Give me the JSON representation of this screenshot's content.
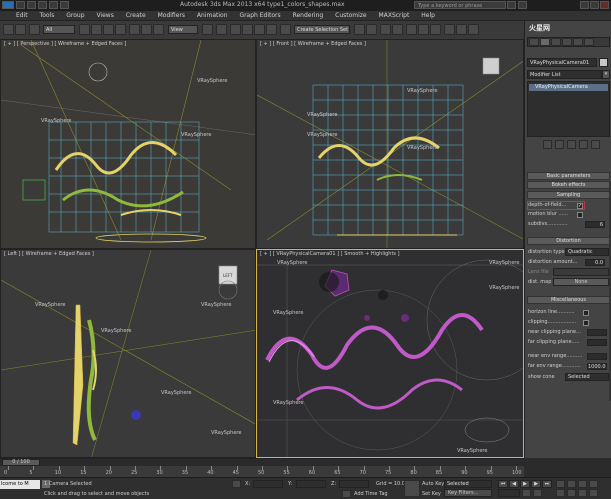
{
  "window": {
    "title": "Autodesk 3ds Max 2013 x64    type1_colors_shapes.max",
    "search_placeholder": "Type a keyword or phrase"
  },
  "menu": [
    "Edit",
    "Tools",
    "Group",
    "Views",
    "Create",
    "Modifiers",
    "Animation",
    "Graph Editors",
    "Rendering",
    "Customize",
    "MAXScript",
    "Help"
  ],
  "toolbar": {
    "selection_filter": "All",
    "reference_coord": "View",
    "named_selection": "Create Selection Set"
  },
  "viewports": {
    "top_left": {
      "label": "[ + ] [ Perspective ] [ Wireframe + Edged Faces ]",
      "objects": [
        "VRaySphere",
        "VRaySphere",
        "VRaySphere"
      ]
    },
    "top_right": {
      "label": "[ + ] [ Front ] [ Wireframe + Edged Faces ]",
      "objects": [
        "VRaySphere",
        "VRaySphere",
        "VRaySphere",
        "VRaySphere"
      ]
    },
    "bottom_left": {
      "label": "[ Left ] [ Wireframe + Edged Faces ]",
      "objects": [
        "VRaySphere",
        "VRaySphere",
        "VRaySphere",
        "VRaySphere",
        "VRaySphere"
      ],
      "viewcube": "LEFT"
    },
    "bottom_right": {
      "label": "[ + ] [ VRayPhysicalCamera01 ] [ Smooth + Highlights ]",
      "objects": [
        "VRaySphere",
        "VRaySphere",
        "VRaySphere",
        "VRaySphere",
        "VRaySphere",
        "VRaySphere"
      ]
    }
  },
  "command_panel": {
    "object_name": "VRayPhysicalCamera01",
    "modifier_list": "Modifier List",
    "stack_item": "VRayPhysicalCamera",
    "rollouts": {
      "basic": "Basic parameters",
      "bokeh": "Bokeh effects",
      "sampling": "Sampling",
      "distortion": "Distortion",
      "misc": "Miscellaneous"
    },
    "sampling": {
      "dof": "depth-of-field...",
      "motion_blur": "motion blur ......",
      "subdivs": "subdivs.............",
      "subdivs_value": "6"
    },
    "distortion": {
      "type_label": "distortion type",
      "type_value": "Quadratic",
      "amount_label": "distortion amount...",
      "amount_value": "0.0",
      "lens_file_label": "Lens file",
      "dist_map_label": "dist. map",
      "none_label": "None"
    },
    "misc": {
      "horizon": "horizon line...........",
      "clipping": "clipping..................",
      "near_clip": "near clipping plane...",
      "far_clip": "far clipping plane.....",
      "near_env": "near env range..........",
      "far_env": "far env range............",
      "far_env_value": "1000.0",
      "show_cone": "show cone",
      "show_cone_value": "Selected"
    }
  },
  "timeline": {
    "frame_counter": "0 / 100",
    "ticks": [
      "0",
      "5",
      "10",
      "15",
      "20",
      "25",
      "30",
      "35",
      "40",
      "45",
      "50",
      "55",
      "60",
      "65",
      "70",
      "75",
      "80",
      "85",
      "90",
      "95",
      "100"
    ]
  },
  "status": {
    "maxscript": "lcome to M",
    "selected": "1 Camera Selected",
    "prompt": "Click and drag to select and move objects",
    "x_label": "X:",
    "y_label": "Y:",
    "z_label": "Z:",
    "grid": "Grid = 10.0",
    "auto_key": "Auto Key",
    "set_key": "Set Key",
    "selected_mode": "Selected",
    "key_filters": "Key Filters...",
    "add_time_tag": "Add Time Tag"
  },
  "watermark": "火星网"
}
